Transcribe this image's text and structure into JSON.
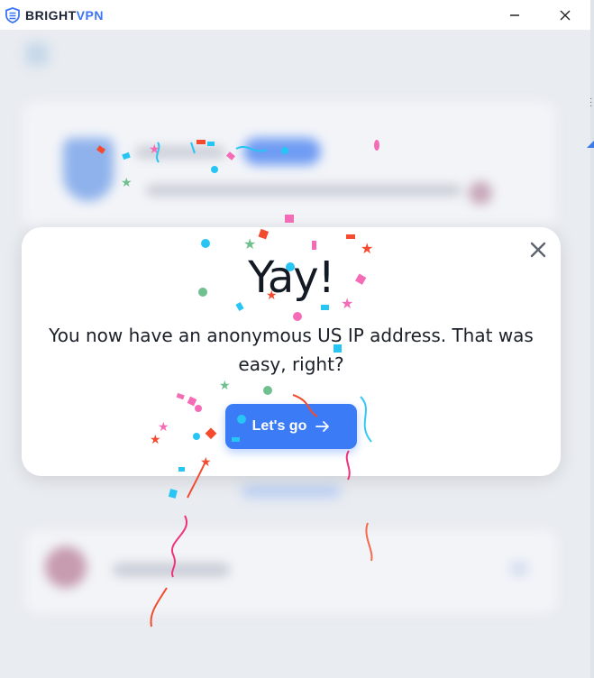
{
  "window": {
    "brand_main": "BRIGHT",
    "brand_accent": "VPN"
  },
  "modal": {
    "title": "Yay!",
    "message": "You now have an anonymous US IP address. That was easy, right?",
    "cta_label": "Let's go"
  },
  "colors": {
    "accent": "#3b7cf6",
    "title_text": "#141a24",
    "background_dim": "#e9ecf1"
  },
  "icons": {
    "logo": "shield-icon",
    "minimize": "minimize-icon",
    "close_window": "close-icon",
    "close_modal": "close-icon",
    "cta_arrow": "arrow-right-icon"
  }
}
